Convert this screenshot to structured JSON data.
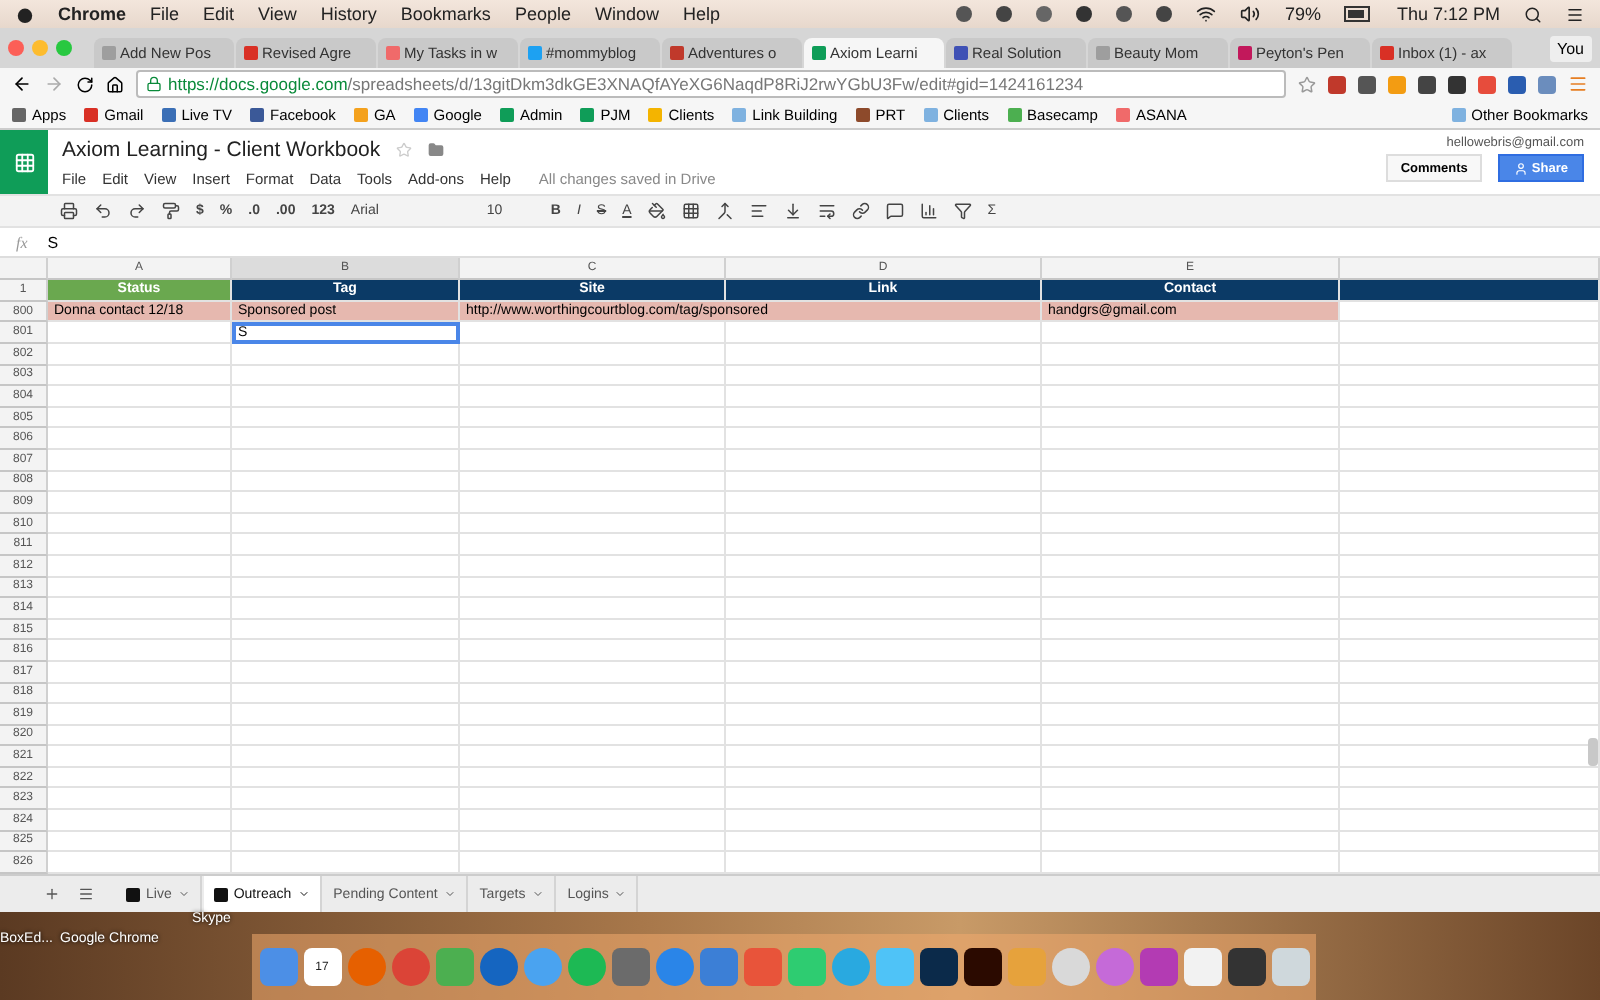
{
  "menubar": {
    "items": [
      "Chrome",
      "File",
      "Edit",
      "View",
      "History",
      "Bookmarks",
      "People",
      "Window",
      "Help"
    ],
    "battery": "79%",
    "time": "Thu 7:12 PM"
  },
  "browser": {
    "tabs": [
      {
        "title": "Add New Pos",
        "selected": false,
        "color": "#9e9e9e"
      },
      {
        "title": "Revised Agre",
        "selected": false,
        "color": "#d93025"
      },
      {
        "title": "My Tasks in w",
        "selected": false,
        "color": "#f06a6a"
      },
      {
        "title": "#mommyblog",
        "selected": false,
        "color": "#1da1f2"
      },
      {
        "title": "Adventures o",
        "selected": false,
        "color": "#c0392b"
      },
      {
        "title": "Axiom Learni",
        "selected": true,
        "color": "#0f9d58"
      },
      {
        "title": "Real Solution",
        "selected": false,
        "color": "#3f51b5"
      },
      {
        "title": "Beauty Mom",
        "selected": false,
        "color": "#9e9e9e"
      },
      {
        "title": "Peyton's Pen",
        "selected": false,
        "color": "#c2185b"
      },
      {
        "title": "Inbox (1) - ax",
        "selected": false,
        "color": "#d93025"
      }
    ],
    "profile": "You",
    "url_host": "https://docs.google.com",
    "url_path": "/spreadsheets/d/13gitDkm3dkGE3XNAQfAYeXG6NaqdP8RiJ2rwYGbU3Fw/edit#gid=1424161234",
    "bookmarks": [
      {
        "label": "Apps",
        "color": "#666666"
      },
      {
        "label": "Gmail",
        "color": "#d93025"
      },
      {
        "label": "Live TV",
        "color": "#3b6fb6"
      },
      {
        "label": "Facebook",
        "color": "#3b5998"
      },
      {
        "label": "GA",
        "color": "#f4a11d"
      },
      {
        "label": "Google",
        "color": "#4285f4"
      },
      {
        "label": "Admin",
        "color": "#0f9d58"
      },
      {
        "label": "PJM",
        "color": "#0f9d58"
      },
      {
        "label": "Clients",
        "color": "#f4b400"
      },
      {
        "label": "Link Building",
        "color": "#7fb2e0"
      },
      {
        "label": "PRT",
        "color": "#8d4a2b"
      },
      {
        "label": "Clients",
        "color": "#7fb2e0"
      },
      {
        "label": "Basecamp",
        "color": "#4caf50"
      },
      {
        "label": "ASANA",
        "color": "#f06a6a"
      }
    ],
    "other_bookmarks": "Other Bookmarks"
  },
  "doc": {
    "title": "Axiom Learning - Client Workbook",
    "menu": [
      "File",
      "Edit",
      "View",
      "Insert",
      "Format",
      "Data",
      "Tools",
      "Add-ons",
      "Help"
    ],
    "save_status": "All changes saved in Drive",
    "account": "hellowebris@gmail.com",
    "comments": "Comments",
    "share": "Share",
    "toolbar": {
      "currency": "$",
      "percent": "%",
      "dec_less": ".0",
      "dec_more": ".00",
      "formats": "123",
      "font": "Arial",
      "size": "10",
      "bold": "B",
      "italic": "I",
      "strike": "S",
      "underline_a": "A",
      "functions": "Σ"
    },
    "formula": {
      "label": "fx",
      "value": "S"
    }
  },
  "sheet": {
    "columns": [
      "A",
      "B",
      "C",
      "D",
      "E"
    ],
    "header_row": {
      "number": "1",
      "cells": [
        {
          "text": "Status",
          "color": "#6aa84f"
        },
        {
          "text": "Tag",
          "color": "#0b3a66"
        },
        {
          "text": "Site",
          "color": "#0b3a66"
        },
        {
          "text": "Link",
          "color": "#0b3a66"
        },
        {
          "text": "Contact",
          "color": "#0b3a66"
        }
      ]
    },
    "rows": [
      {
        "number": "800",
        "highlighted": true,
        "cells": [
          {
            "text": "Donna contact 12/18",
            "editing": false
          },
          {
            "text": "Sponsored post",
            "editing": false
          },
          {
            "text": "http://www.worthingcourtblog.com/tag/sponsored",
            "editing": false
          },
          {
            "text": "",
            "editing": false
          },
          {
            "text": "handgrs@gmail.com",
            "editing": false
          }
        ]
      },
      {
        "number": "801",
        "highlighted": false,
        "cells": [
          {
            "text": "",
            "editing": false
          },
          {
            "text": "S",
            "editing": true
          },
          {
            "text": "",
            "editing": false
          },
          {
            "text": "",
            "editing": false
          },
          {
            "text": "",
            "editing": false
          }
        ]
      },
      {
        "number": "802",
        "highlighted": false,
        "cells": []
      },
      {
        "number": "803",
        "highlighted": false,
        "cells": []
      },
      {
        "number": "804",
        "highlighted": false,
        "cells": []
      },
      {
        "number": "805",
        "highlighted": false,
        "cells": []
      },
      {
        "number": "806",
        "highlighted": false,
        "cells": []
      },
      {
        "number": "807",
        "highlighted": false,
        "cells": []
      },
      {
        "number": "808",
        "highlighted": false,
        "cells": []
      },
      {
        "number": "809",
        "highlighted": false,
        "cells": []
      },
      {
        "number": "810",
        "highlighted": false,
        "cells": []
      },
      {
        "number": "811",
        "highlighted": false,
        "cells": []
      },
      {
        "number": "812",
        "highlighted": false,
        "cells": []
      },
      {
        "number": "813",
        "highlighted": false,
        "cells": []
      },
      {
        "number": "814",
        "highlighted": false,
        "cells": []
      },
      {
        "number": "815",
        "highlighted": false,
        "cells": []
      },
      {
        "number": "816",
        "highlighted": false,
        "cells": []
      },
      {
        "number": "817",
        "highlighted": false,
        "cells": []
      },
      {
        "number": "818",
        "highlighted": false,
        "cells": []
      },
      {
        "number": "819",
        "highlighted": false,
        "cells": []
      },
      {
        "number": "820",
        "highlighted": false,
        "cells": []
      },
      {
        "number": "821",
        "highlighted": false,
        "cells": []
      },
      {
        "number": "822",
        "highlighted": false,
        "cells": []
      },
      {
        "number": "823",
        "highlighted": false,
        "cells": []
      },
      {
        "number": "824",
        "highlighted": false,
        "cells": []
      },
      {
        "number": "825",
        "highlighted": false,
        "cells": []
      },
      {
        "number": "826",
        "highlighted": false,
        "cells": []
      }
    ],
    "tabs": [
      {
        "label": "Live",
        "selected": false,
        "icon": true
      },
      {
        "label": "Outreach",
        "selected": true,
        "icon": true
      },
      {
        "label": "Pending Content",
        "selected": false,
        "icon": false
      },
      {
        "label": "Targets",
        "selected": false,
        "icon": false
      },
      {
        "label": "Logins",
        "selected": false,
        "icon": false
      }
    ]
  },
  "desktop": {
    "labels": [
      "Skype",
      "BoxEd...",
      "Google Chrome"
    ],
    "calendar_day": "17"
  }
}
